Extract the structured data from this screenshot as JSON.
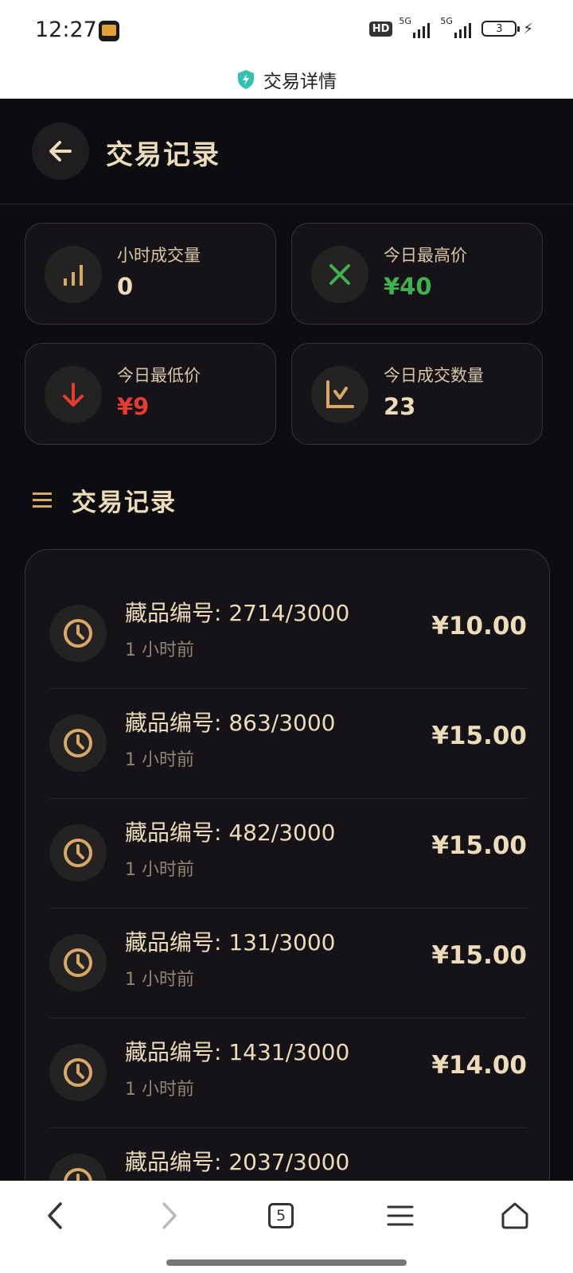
{
  "status_bar": {
    "time": "12:27",
    "network_hd": "HD",
    "network_1": "5G",
    "network_2": "5G",
    "battery_level": "3"
  },
  "browser": {
    "title": "交易详情"
  },
  "header": {
    "title": "交易记录"
  },
  "stats": [
    {
      "label": "小时成交量",
      "value": "0",
      "icon": "bar-chart-icon",
      "value_color": "#ecdcb9"
    },
    {
      "label": "今日最高价",
      "value": "¥40",
      "icon": "close-x-icon",
      "value_color": "#3fb24f"
    },
    {
      "label": "今日最低价",
      "value": "¥9",
      "icon": "arrow-down-icon",
      "value_color": "#e53c32"
    },
    {
      "label": "今日成交数量",
      "value": "23",
      "icon": "trend-chart-icon",
      "value_color": "#ecdcb9"
    }
  ],
  "section": {
    "title": "交易记录"
  },
  "records": [
    {
      "id": "藏品编号: 2714/3000",
      "time": "1 小时前",
      "price": "¥10.00"
    },
    {
      "id": "藏品编号: 863/3000",
      "time": "1 小时前",
      "price": "¥15.00"
    },
    {
      "id": "藏品编号: 482/3000",
      "time": "1 小时前",
      "price": "¥15.00"
    },
    {
      "id": "藏品编号: 131/3000",
      "time": "1 小时前",
      "price": "¥15.00"
    },
    {
      "id": "藏品编号: 1431/3000",
      "time": "1 小时前",
      "price": "¥14.00"
    },
    {
      "id": "藏品编号: 2037/3000",
      "time": "",
      "price": ""
    }
  ],
  "bottom_nav": {
    "tab_count": "5"
  },
  "colors": {
    "background": "#0d0c10",
    "card": "#151317",
    "gold": "#d7a868",
    "text": "#ecdcb9",
    "green": "#3fb24f",
    "red": "#e53c32"
  }
}
